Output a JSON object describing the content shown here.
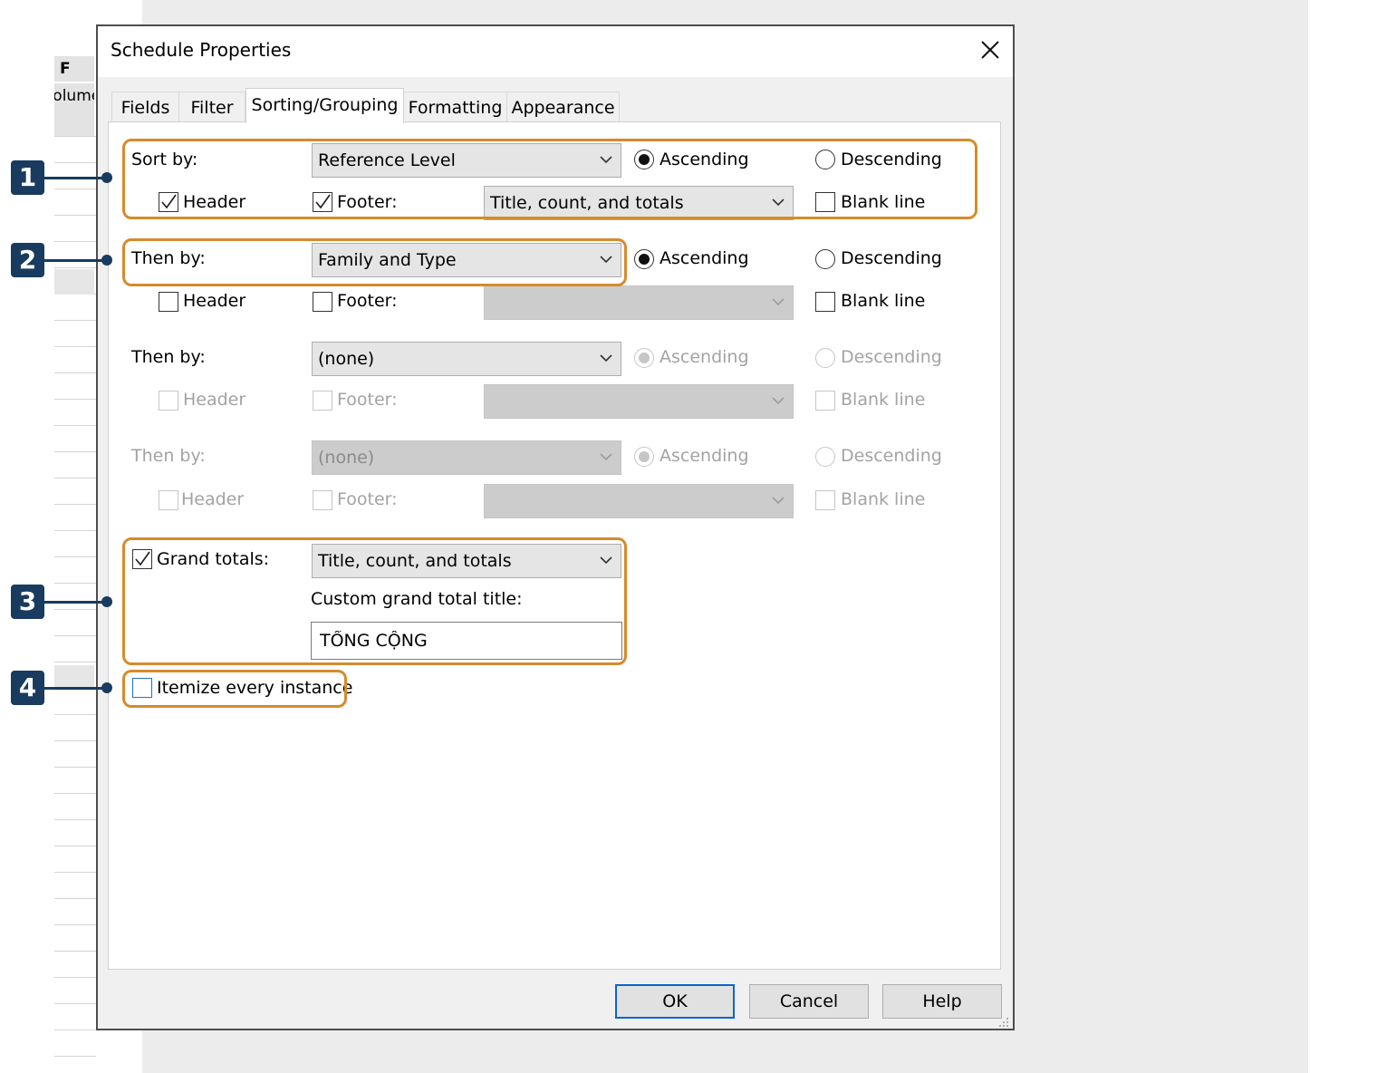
{
  "background_app": {
    "column_header": "F",
    "column_subheader": "Volume"
  },
  "dialog": {
    "title": "Schedule Properties",
    "close_glyph": "✕"
  },
  "tabs": [
    {
      "label": "Fields",
      "active": false
    },
    {
      "label": "Filter",
      "active": false
    },
    {
      "label": "Sorting/Grouping",
      "active": true
    },
    {
      "label": "Formatting",
      "active": false
    },
    {
      "label": "Appearance",
      "active": false
    }
  ],
  "sort_rows": [
    {
      "label": "Sort by:",
      "field": "Reference Level",
      "ascending_label": "Ascending",
      "descending_label": "Descending",
      "order": "ascending",
      "header_label": "Header",
      "header_checked": true,
      "footer_label": "Footer:",
      "footer_checked": true,
      "footer_value": "Title, count, and totals",
      "blank_line_label": "Blank line",
      "blank_line_checked": false,
      "enabled": true
    },
    {
      "label": "Then by:",
      "field": "Family and Type",
      "ascending_label": "Ascending",
      "descending_label": "Descending",
      "order": "ascending",
      "header_label": "Header",
      "header_checked": false,
      "footer_label": "Footer:",
      "footer_checked": false,
      "footer_value": "",
      "blank_line_label": "Blank line",
      "blank_line_checked": false,
      "enabled": true
    },
    {
      "label": "Then by:",
      "field": "(none)",
      "ascending_label": "Ascending",
      "descending_label": "Descending",
      "order": "ascending",
      "header_label": "Header",
      "header_checked": false,
      "footer_label": "Footer:",
      "footer_checked": false,
      "footer_value": "",
      "blank_line_label": "Blank line",
      "blank_line_checked": false,
      "enabled": "partial"
    },
    {
      "label": "Then by:",
      "field": "(none)",
      "ascending_label": "Ascending",
      "descending_label": "Descending",
      "order": "ascending",
      "header_label": "Header",
      "header_checked": false,
      "footer_label": "Footer:",
      "footer_checked": false,
      "footer_value": "",
      "blank_line_label": "Blank line",
      "blank_line_checked": false,
      "enabled": false
    }
  ],
  "grand_totals": {
    "label": "Grand totals:",
    "checked": true,
    "value": "Title, count, and totals",
    "custom_title_label": "Custom grand total title:",
    "custom_title_value": "TỔNG CỘNG"
  },
  "itemize": {
    "label": "Itemize every instance",
    "checked": false
  },
  "buttons": {
    "ok": "OK",
    "cancel": "Cancel",
    "help": "Help"
  },
  "callouts": [
    "1",
    "2",
    "3",
    "4"
  ],
  "colors": {
    "highlight": "#d58b2e",
    "callout": "#183b5f",
    "default_button_border": "#0a64c8"
  },
  "icons": {
    "close": "close-icon",
    "dropdown": "chevron-down-icon",
    "check": "checkmark-icon",
    "grip": "resize-grip-icon"
  }
}
